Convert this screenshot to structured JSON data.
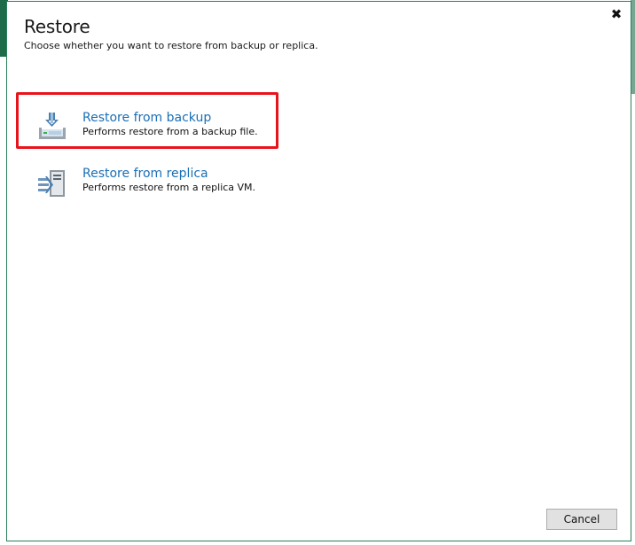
{
  "dialog": {
    "title": "Restore",
    "subtitle": "Choose whether you want to restore from backup or replica.",
    "close_glyph": "✖",
    "close_icon": "close-icon"
  },
  "options": [
    {
      "title": "Restore from backup",
      "description": "Performs restore from a backup file.",
      "icon": "backup-download-icon",
      "selected": true
    },
    {
      "title": "Restore from replica",
      "description": "Performs restore from a replica VM.",
      "icon": "replica-server-icon",
      "selected": false
    }
  ],
  "footer": {
    "cancel_label": "Cancel"
  },
  "colors": {
    "link": "#1a6fb5",
    "highlight": "#e8141c",
    "accent": "#1d6b49"
  }
}
